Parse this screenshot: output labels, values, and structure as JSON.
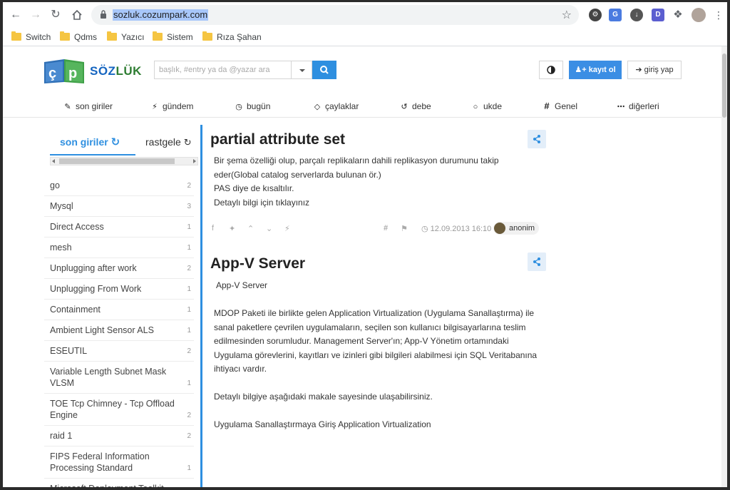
{
  "browser": {
    "url": "sozluk.cozumpark.com",
    "bookmarks": [
      "Switch",
      "Qdms",
      "Yazıcı",
      "Sistem",
      "Rıza Şahan"
    ]
  },
  "site": {
    "logo_text_a": "SÖZ",
    "logo_text_b": "LÜK",
    "search_placeholder": "başlık, #entry ya da @yazar ara",
    "register_label": "kayıt ol",
    "login_label": "giriş yap",
    "nav": [
      {
        "label": "son giriler",
        "icon": "pencil-icon"
      },
      {
        "label": "gündem",
        "icon": "bolt-icon"
      },
      {
        "label": "bugün",
        "icon": "clock-icon"
      },
      {
        "label": "çaylaklar",
        "icon": "diamond-icon"
      },
      {
        "label": "debe",
        "icon": "history-icon"
      },
      {
        "label": "ukde",
        "icon": "circle-icon"
      },
      {
        "label": "Genel",
        "icon": "hash-icon"
      },
      {
        "label": "diğerleri",
        "icon": "more-icon"
      }
    ]
  },
  "sidebar": {
    "tab_active": "son giriler",
    "tab_other": "rastgele",
    "topics": [
      {
        "title": "go",
        "count": "2"
      },
      {
        "title": "Mysql",
        "count": "3"
      },
      {
        "title": "Direct Access",
        "count": "1"
      },
      {
        "title": "mesh",
        "count": "1"
      },
      {
        "title": "Unplugging after work",
        "count": "2"
      },
      {
        "title": "Unplugging From Work",
        "count": "1"
      },
      {
        "title": "Containment",
        "count": "1"
      },
      {
        "title": "Ambient Light Sensor ALS",
        "count": "1"
      },
      {
        "title": "ESEUTIL",
        "count": "2"
      },
      {
        "title": "Variable Length Subnet Mask VLSM",
        "count": "1"
      },
      {
        "title": "TOE Tcp Chimney - Tcp Offload Engine",
        "count": "2"
      },
      {
        "title": "raid 1",
        "count": "2"
      },
      {
        "title": "FIPS Federal Information Processing Standard",
        "count": "1"
      },
      {
        "title": "Microsoft Deployment Toolkit MDT",
        "count": ""
      }
    ]
  },
  "entries": [
    {
      "title": "partial attribute set",
      "lines": [
        "Bir şema özelliği olup, parçalı replikaların dahili replikasyon durumunu takip eder(Global catalog serverlarda bulunan ör.)",
        "PAS diye de kısaltılır.",
        "Detaylı bilgi için tıklayınız"
      ],
      "date": "12.09.2013 16:10",
      "author": "anonim"
    },
    {
      "title": "App-V Server",
      "lines": [
        " App-V Server",
        "",
        "MDOP Paketi ile birlikte gelen Application Virtualization (Uygulama Sanallaştırma) ile sanal paketlere çevrilen uygulamaların, seçilen son kullanıcı bilgisayarlarına teslim edilmesinden sorumludur. Management Server'ın; App-V Yönetim ortamındaki Uygulama görevlerini, kayıtları ve izinleri gibi bilgileri alabilmesi için SQL Veritabanına ihtiyacı vardır.",
        "",
        "Detaylı bilgiye aşağıdaki makale sayesinde ulaşabilirsiniz.",
        "",
        "Uygulama Sanallaştırmaya Giriş Application Virtualization"
      ]
    }
  ]
}
